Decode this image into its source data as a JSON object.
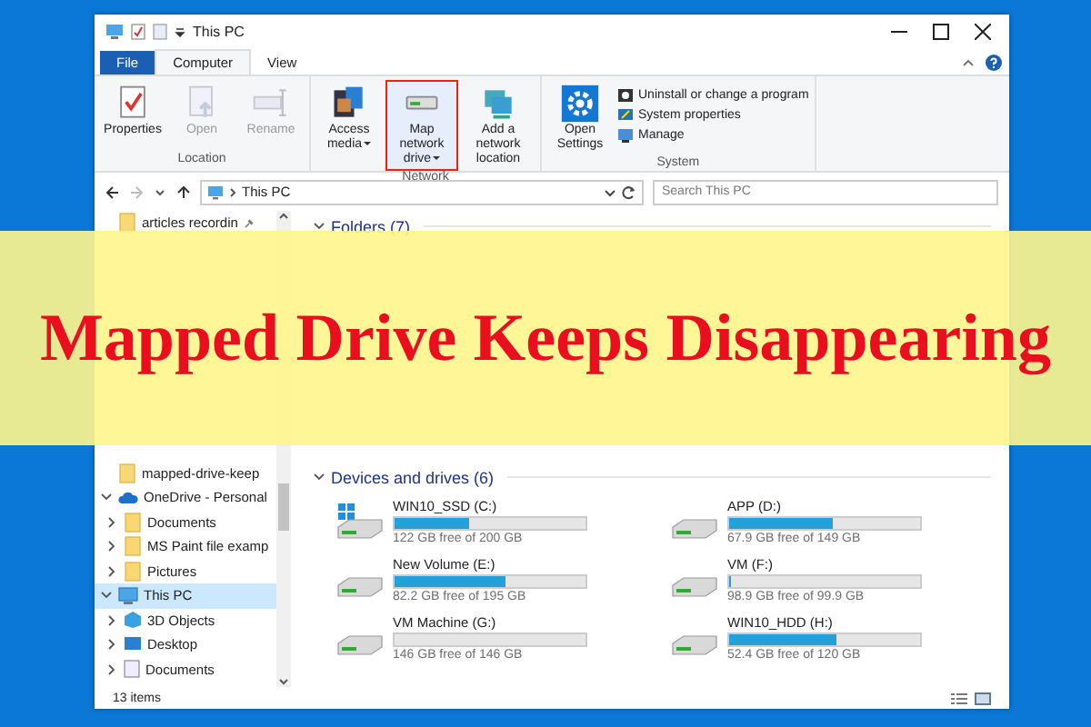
{
  "window": {
    "title": "This PC"
  },
  "ribbon_tabs": [
    {
      "label": "File",
      "kind": "file",
      "selected": false
    },
    {
      "label": "Computer",
      "kind": "tab",
      "selected": true
    },
    {
      "label": "View",
      "kind": "tab",
      "selected": false
    }
  ],
  "ribbon_groups": [
    {
      "name": "Location",
      "items": [
        {
          "label": "Properties",
          "kind": "large",
          "disabled": false,
          "highlighted": false,
          "dropdown": false
        },
        {
          "label": "Open",
          "kind": "large",
          "disabled": true,
          "highlighted": false,
          "dropdown": false
        },
        {
          "label": "Rename",
          "kind": "large",
          "disabled": true,
          "highlighted": false,
          "dropdown": false
        }
      ]
    },
    {
      "name": "Network",
      "items": [
        {
          "label": "Access media",
          "kind": "large",
          "disabled": false,
          "highlighted": false,
          "dropdown": true
        },
        {
          "label": "Map network drive",
          "kind": "large",
          "disabled": false,
          "highlighted": true,
          "dropdown": true
        },
        {
          "label": "Add a network location",
          "kind": "large",
          "disabled": false,
          "highlighted": false,
          "dropdown": false
        }
      ]
    },
    {
      "name": "System",
      "items": [
        {
          "label": "Open Settings",
          "kind": "large",
          "disabled": false,
          "highlighted": false,
          "dropdown": false
        },
        {
          "label": "Uninstall or change a program",
          "kind": "small"
        },
        {
          "label": "System properties",
          "kind": "small"
        },
        {
          "label": "Manage",
          "kind": "small"
        }
      ]
    }
  ],
  "address": {
    "path": "This PC"
  },
  "search": {
    "placeholder": "Search This PC"
  },
  "sidebar": {
    "pinned": [
      {
        "label": "articles recordin",
        "selected": false
      }
    ],
    "items": [
      {
        "label": "mapped-drive-keep",
        "selected": false
      },
      {
        "label": "OneDrive - Personal",
        "kind": "cloud",
        "expanded": true,
        "selected": false,
        "children": [
          {
            "label": "Documents",
            "expanded": false,
            "selected": false
          },
          {
            "label": "MS Paint file examp",
            "expanded": false,
            "selected": false
          },
          {
            "label": "Pictures",
            "expanded": false,
            "selected": false
          }
        ]
      },
      {
        "label": "This PC",
        "kind": "pc",
        "expanded": true,
        "selected": true,
        "children": [
          {
            "label": "3D Objects",
            "kind": "objects",
            "expanded": false,
            "selected": false
          },
          {
            "label": "Desktop",
            "kind": "desktop",
            "expanded": false,
            "selected": false
          },
          {
            "label": "Documents",
            "kind": "documents",
            "expanded": false,
            "selected": false
          }
        ]
      }
    ]
  },
  "folders": {
    "title": "Folders (7)",
    "expanded": true
  },
  "drives": {
    "title": "Devices and drives (6)",
    "expanded": true,
    "items": [
      {
        "name": "WIN10_SSD (C:)",
        "free": "122 GB free of 200 GB",
        "level": 0.39,
        "kind": "system"
      },
      {
        "name": "APP (D:)",
        "free": "67.9 GB free of 149 GB",
        "level": 0.54,
        "kind": "disk"
      },
      {
        "name": "New Volume (E:)",
        "free": "82.2 GB free of 195 GB",
        "level": 0.58,
        "kind": "disk"
      },
      {
        "name": "VM (F:)",
        "free": "98.9 GB free of 99.9 GB",
        "level": 0.01,
        "kind": "disk"
      },
      {
        "name": "VM Machine (G:)",
        "free": "146 GB free of 146 GB",
        "level": 0.0,
        "kind": "disk"
      },
      {
        "name": "WIN10_HDD (H:)",
        "free": "52.4 GB free of 120 GB",
        "level": 0.56,
        "kind": "disk"
      }
    ]
  },
  "status_bar": {
    "items": "13 items"
  },
  "banner": {
    "title": "Mapped Drive Keeps Disappearing"
  }
}
